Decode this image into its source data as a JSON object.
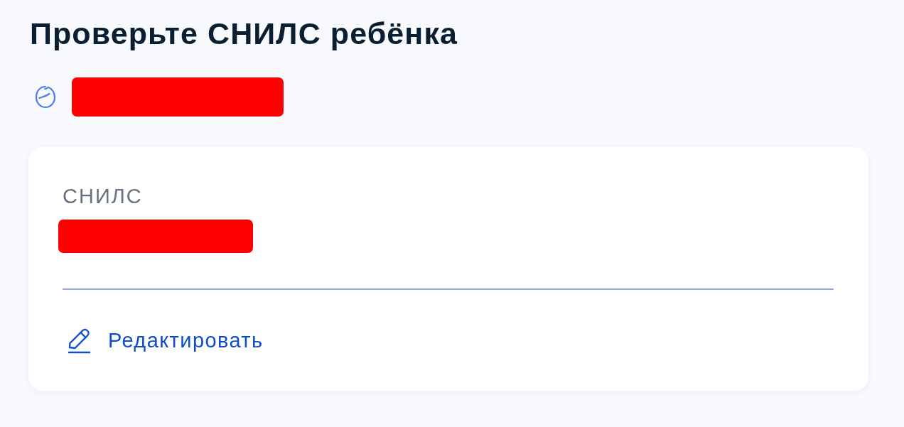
{
  "title": "Проверьте СНИЛС ребёнка",
  "child": {
    "name_redacted": true
  },
  "card": {
    "fields": [
      {
        "label": "СНИЛС",
        "value_redacted": true
      }
    ],
    "edit_link": "Редактировать"
  }
}
